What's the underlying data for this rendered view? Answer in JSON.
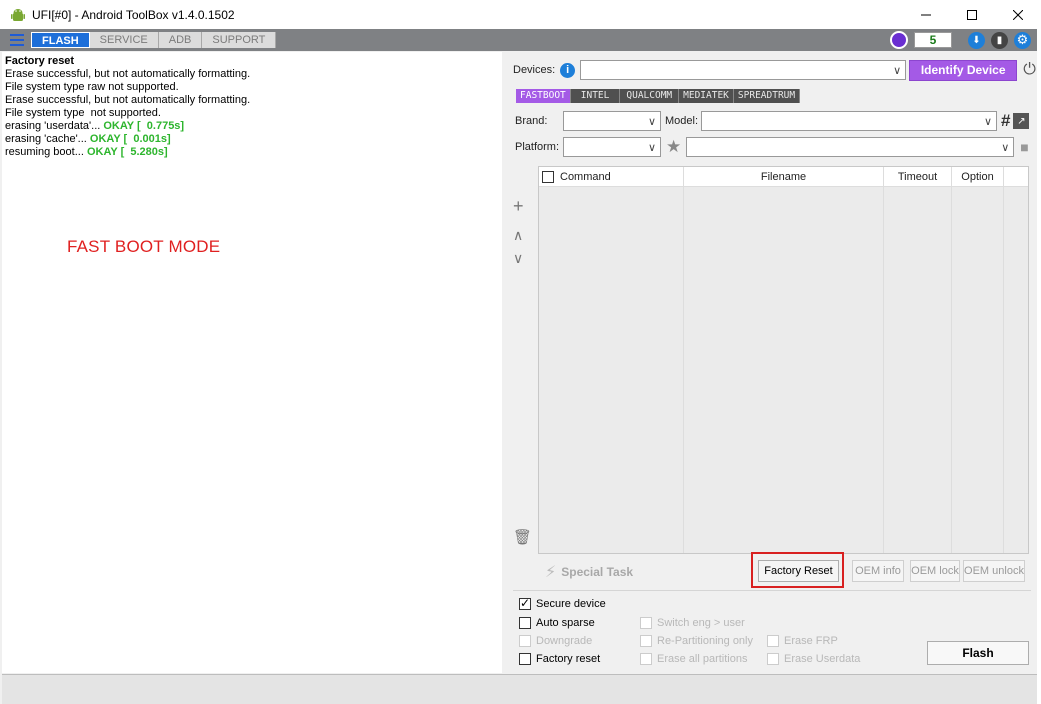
{
  "window": {
    "title": "UFI[#0] - Android ToolBox v1.4.0.1502",
    "minimize": "—",
    "maximize": "☐",
    "close": "✕"
  },
  "menu": {
    "tabs": [
      "FLASH",
      "SERVICE",
      "ADB",
      "SUPPORT"
    ],
    "active_tab": "FLASH",
    "count": "5"
  },
  "log": {
    "lines": [
      {
        "text": "Factory reset",
        "bold": true
      },
      {
        "text": "Erase successful, but not automatically formatting."
      },
      {
        "text": "File system type raw not supported."
      },
      {
        "text": "Erase successful, but not automatically formatting."
      },
      {
        "text": "File system type  not supported."
      },
      {
        "text": "erasing 'userdata'... ",
        "ok": "OKAY [  0.775s]"
      },
      {
        "text": "erasing 'cache'... ",
        "ok": "OKAY [  0.001s]"
      },
      {
        "text": "resuming boot... ",
        "ok": "OKAY [  5.280s]"
      }
    ],
    "note": "FAST BOOT MODE"
  },
  "devices": {
    "label": "Devices:",
    "value": "",
    "identify_label": "Identify Device"
  },
  "subtabs": [
    "FASTBOOT",
    "INTEL",
    "QUALCOMM",
    "MEDIATEK",
    "SPREADTRUM"
  ],
  "active_subtab": "FASTBOOT",
  "brand": {
    "label": "Brand:",
    "value": ""
  },
  "model": {
    "label": "Model:",
    "value": ""
  },
  "platform": {
    "label": "Platform:",
    "value": "",
    "preset_value": ""
  },
  "table": {
    "columns": [
      "Command",
      "Filename",
      "Timeout",
      "Option"
    ]
  },
  "special_task_label": "Special Task",
  "buttons": {
    "factory_reset": "Factory Reset",
    "oem_info": "OEM info",
    "oem_lock": "OEM lock",
    "oem_unlock": "OEM unlock",
    "flash": "Flash"
  },
  "options": {
    "secure_device": {
      "label": "Secure device",
      "checked": true,
      "enabled": true
    },
    "auto_sparse": {
      "label": "Auto sparse",
      "checked": false,
      "enabled": true
    },
    "downgrade": {
      "label": "Downgrade",
      "checked": false,
      "enabled": false
    },
    "factory_reset": {
      "label": "Factory reset",
      "checked": false,
      "enabled": true
    },
    "switch_eng_user": {
      "label": "Switch eng > user",
      "checked": false,
      "enabled": false
    },
    "repartitioning_only": {
      "label": "Re-Partitioning only",
      "checked": false,
      "enabled": false
    },
    "erase_all_partitions": {
      "label": "Erase all partitions",
      "checked": false,
      "enabled": false
    },
    "erase_frp": {
      "label": "Erase FRP",
      "checked": false,
      "enabled": false
    },
    "erase_userdata": {
      "label": "Erase Userdata",
      "checked": false,
      "enabled": false
    }
  },
  "colors": {
    "accent_purple": "#a45ae6",
    "flash_tab_blue": "#1e6fd9",
    "ok_green": "#2db52d",
    "note_red": "#e02020",
    "highlight_red": "#d82020"
  }
}
